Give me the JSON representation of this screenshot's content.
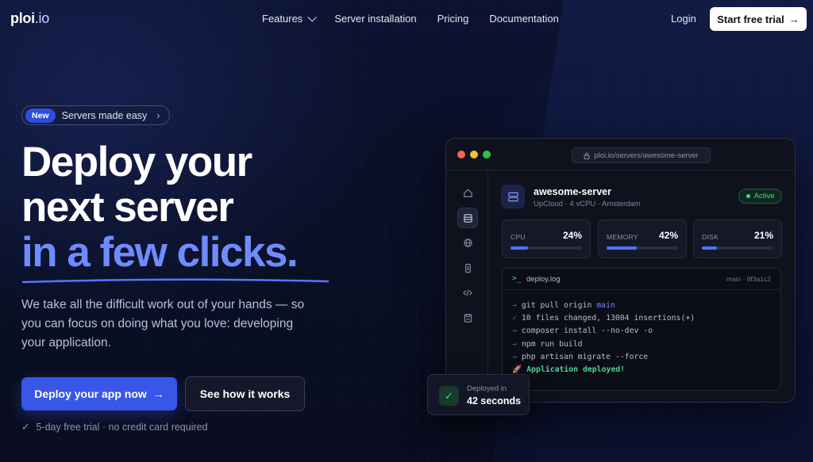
{
  "brand": {
    "logo_main": "ploi",
    "logo_tld": ".io"
  },
  "nav": {
    "features": "Features",
    "server_installation": "Server installation",
    "pricing": "Pricing",
    "documentation": "Documentation",
    "login": "Login",
    "cta": "Start free trial"
  },
  "hero": {
    "badge_new": "New",
    "badge_text": "Servers made easy",
    "title_line1": "Deploy your",
    "title_line2": "next server",
    "title_accent": "in a few clicks.",
    "lead": "We take all the difficult work out of your hands — so you can focus on doing what you love: developing your application.",
    "primary_cta": "Deploy your app now",
    "secondary_cta": "See how it works",
    "note": "5-day free trial · no credit card required"
  },
  "app": {
    "url": "ploi.io/servers/awesome-server",
    "server_name": "awesome-server",
    "server_sub": "UpCloud · 4 vCPU · Amsterdam",
    "status": "Active",
    "stats": [
      {
        "label": "CPU",
        "value": "24%",
        "percent": 24
      },
      {
        "label": "MEMORY",
        "value": "42%",
        "percent": 42
      },
      {
        "label": "DISK",
        "value": "21%",
        "percent": 21
      }
    ],
    "log": {
      "prompt": ">_",
      "filename": "deploy.log",
      "branch": "main · 9f3a1c2",
      "lines": [
        {
          "prefix": "→",
          "text": "git pull origin ",
          "keyword": "main"
        },
        {
          "prefix": "✓",
          "text": "10 files changed, 13004 insertions(+)"
        },
        {
          "prefix": "→",
          "text": "composer install --no-dev -o"
        },
        {
          "prefix": "→",
          "text": "npm run build"
        },
        {
          "prefix": "→",
          "text": "php artisan migrate --force"
        },
        {
          "prefix": "🚀",
          "text": "Application deployed!"
        }
      ]
    }
  },
  "deploy_card": {
    "label": "Deployed in",
    "value": "42 seconds"
  },
  "colors": {
    "accent": "#6f8bff",
    "primary_button": "#3856e8",
    "success": "#44d68e",
    "background": "#0b1024"
  }
}
